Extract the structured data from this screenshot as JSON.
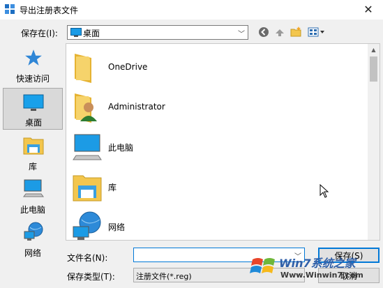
{
  "window": {
    "title": "导出注册表文件"
  },
  "toolbar": {
    "save_in_label": "保存在(I):",
    "location_value": "桌面",
    "back_icon": "back-icon",
    "up_icon": "up-folder-icon",
    "new_folder_icon": "new-folder-icon",
    "view_icon": "view-menu-icon"
  },
  "places": [
    {
      "label": "快速访问",
      "icon": "star-icon"
    },
    {
      "label": "桌面",
      "icon": "desktop-icon",
      "selected": true
    },
    {
      "label": "库",
      "icon": "library-icon"
    },
    {
      "label": "此电脑",
      "icon": "computer-icon"
    },
    {
      "label": "网络",
      "icon": "network-icon"
    }
  ],
  "files": [
    {
      "name": "OneDrive",
      "icon": "folder-icon"
    },
    {
      "name": "Administrator",
      "icon": "user-folder-icon"
    },
    {
      "name": "此电脑",
      "icon": "computer-icon"
    },
    {
      "name": "库",
      "icon": "library-icon"
    },
    {
      "name": "网络",
      "icon": "network-icon"
    }
  ],
  "form": {
    "filename_label": "文件名(N):",
    "filename_value": "",
    "filetype_label": "保存类型(T):",
    "filetype_value": "注册文件(*.reg)",
    "save_button": "保存(S)",
    "cancel_button": "取消"
  },
  "watermark": {
    "brand": "Win7系统之家",
    "url": "Www.Winwin7.com"
  },
  "colors": {
    "accent": "#0078d7",
    "selection": "#d9d9d9",
    "background": "#f0f0f0"
  }
}
